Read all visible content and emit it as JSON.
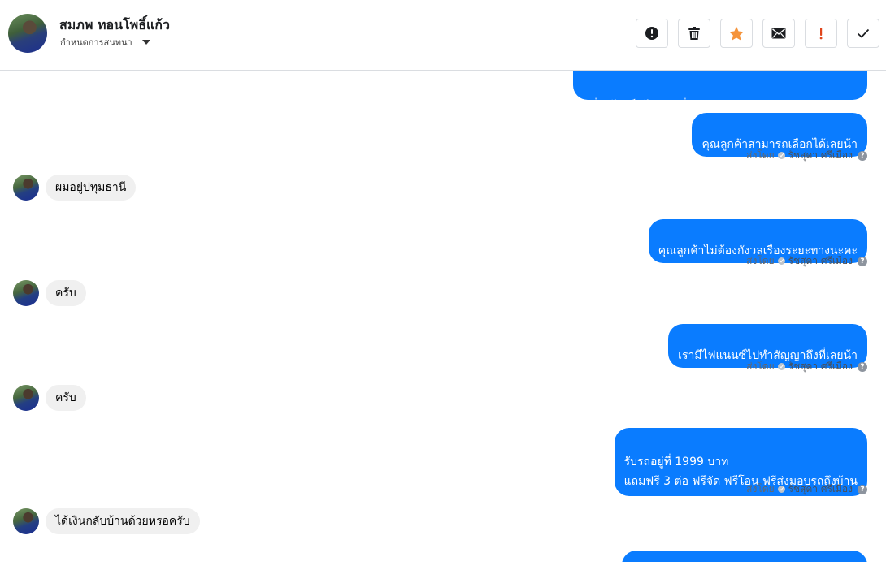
{
  "header": {
    "contact_name": "สมภพ ทอนโพธิ์แก้ว",
    "subtitle": "กำหนดการสนทนา",
    "actions": [
      {
        "icon": "alert-circle-icon",
        "color": "#1c1e21"
      },
      {
        "icon": "trash-icon",
        "color": "#1c1e21"
      },
      {
        "icon": "star-icon",
        "color": "#f5933a"
      },
      {
        "icon": "envelope-icon",
        "color": "#1c1e21"
      },
      {
        "icon": "exclamation-icon",
        "color": "#e0451c"
      },
      {
        "icon": "check-icon",
        "color": "#1c1e21"
      }
    ]
  },
  "colors": {
    "outgoing_bubble": "#0a7cff",
    "incoming_bubble": "#f0f0f0"
  },
  "messages": {
    "m0": {
      "text": "*เงื่อนไขเป็นไปตามที่บริษัทกำหนด"
    },
    "m1": {
      "text": "คุณลูกค้าสามารถเลือกได้เลยน้า",
      "sent_by_label": "ส่งโดย",
      "sender": "รัชสุดา ศรีเมือง"
    },
    "m2": {
      "text": "ผมอยู่ปทุมธานี"
    },
    "m3": {
      "text": "คุณลูกค้าไม่ต้องกังวลเรื่องระยะทางนะคะ",
      "sent_by_label": "ส่งโดย",
      "sender": "รัชสุดา ศรีเมือง"
    },
    "m4": {
      "text": "ครับ"
    },
    "m5": {
      "text": "เรามีไฟแนนซ์ไปทำสัญญาถึงที่เลยน้า",
      "sent_by_label": "ส่งโดย",
      "sender": "รัชสุดา ศรีเมือง"
    },
    "m6": {
      "text": "ครับ"
    },
    "m7": {
      "text": "รับรถอยู่ที่  1999 บาท\nแถมฟรี 3 ต่อ ฟรีจัด ฟรีโอน  ฟรีส่งมอบรถถึงบ้าน",
      "sent_by_label": "ส่งโดย",
      "sender": "รัชสุดา ศรีเมือง"
    },
    "m8": {
      "text": "ได้เงินกลับบ้านด้วยหรอครับ"
    }
  }
}
